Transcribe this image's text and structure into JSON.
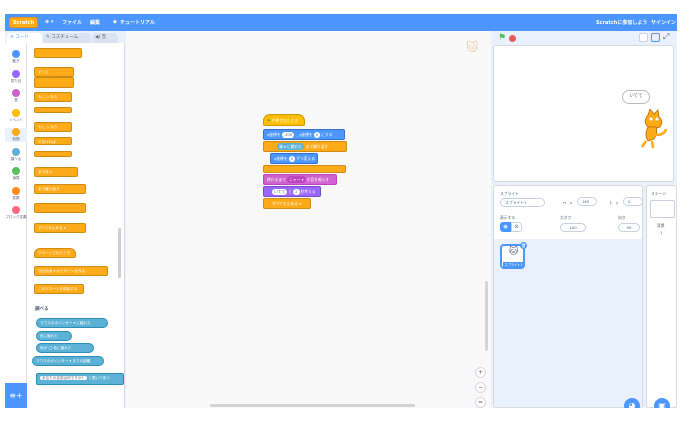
{
  "menubar": {
    "logo": "Scratch",
    "globe": "⊕ ▾",
    "file": "ファイル",
    "edit": "編集",
    "tutorials": "チュートリアル",
    "join": "Scratchに参加しよう",
    "signin": "サインイン"
  },
  "tabs": {
    "code": "コード",
    "costumes": "コスチューム",
    "sounds": "音"
  },
  "categories": [
    {
      "label": "動き",
      "color": "#4c97ff"
    },
    {
      "label": "見た目",
      "color": "#9966ff"
    },
    {
      "label": "音",
      "color": "#cf63cf"
    },
    {
      "label": "イベント",
      "color": "#ffbf00"
    },
    {
      "label": "制御",
      "color": "#ffab19"
    },
    {
      "label": "調べる",
      "color": "#5cb1d6"
    },
    {
      "label": "演算",
      "color": "#59c059"
    },
    {
      "label": "変数",
      "color": "#ff8c1a"
    },
    {
      "label": "ブロック定義",
      "color": "#ff6680"
    }
  ],
  "palette": {
    "b1": "ずっと",
    "b2": "もし ◇ なら",
    "b3": "もし ◇ なら",
    "b3else": "でなければ",
    "b4": "まで待つ",
    "b5": "まで繰り返す",
    "b6": "すべてを止める ▾",
    "b7": "クローンされたとき",
    "b8": "自分自身 ▾ のクローンを作る",
    "b9": "このクローンを削除する",
    "sensing_header": "調べる",
    "s1": "マウスのポインター ▾ に触れた",
    "s2": "色に触れた",
    "s3": "色が ◯ 色に触れた",
    "s4": "マウスのポインター ▾ までの距離",
    "s5a": "あなたの名前は何ですか？",
    "s5b": "と聞いて待つ"
  },
  "script": {
    "hat": "が押されたとき",
    "goto_a": "x座標を",
    "goto_x": "-200",
    "goto_b": "、y座標を",
    "goto_y": "0",
    "goto_c": "にする",
    "repeat_num": "端",
    "repeat_b": "に触れた",
    "repeat_c": "まで繰り返す",
    "change_a": "x座標を",
    "change_v": "5",
    "change_b": "ずつ変える",
    "sound_a": "終わるまで",
    "sound_v": "ニャー ▾",
    "sound_b": "の音を鳴らす",
    "say_a": "",
    "say_v": "いてて",
    "say_b": "と",
    "say_n": "2",
    "say_c": "秒考える",
    "stop": "すべてを止める ▾"
  },
  "stage": {
    "bubble": "いてて"
  },
  "sprite_pane": {
    "sprite_label": "スプライト",
    "sprite_name": "スプライト1",
    "x_label": "x",
    "x": "165",
    "y_label": "y",
    "y": "0",
    "show_label": "表示する",
    "size_label": "大きさ",
    "size": "100",
    "dir_label": "向き",
    "dir": "90",
    "thumb_label": "スプライト1"
  },
  "stage_pane": {
    "title": "ステージ",
    "backdrop_label": "背景",
    "backdrop_count": "1"
  }
}
